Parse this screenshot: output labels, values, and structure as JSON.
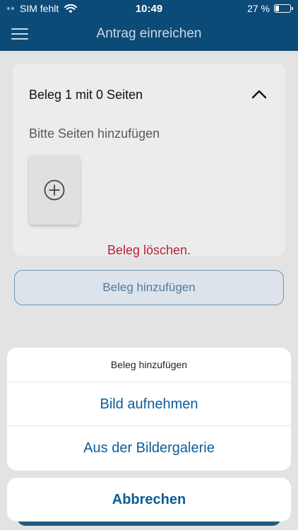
{
  "status_bar": {
    "carrier": "SIM fehlt",
    "time": "10:49",
    "battery_text": "27 %",
    "battery_level": 0.27,
    "icons": [
      "signal-dots-icon",
      "wifi-icon",
      "battery-icon"
    ]
  },
  "nav": {
    "title": "Antrag einreichen",
    "menu_icon": "hamburger-menu-icon"
  },
  "card": {
    "title": "Beleg 1 mit 0 Seiten",
    "collapse_icon": "chevron-up-icon",
    "subtitle": "Bitte Seiten hinzufügen",
    "add_page_icon": "plus-circle-icon",
    "delete_label": "Beleg löschen."
  },
  "add_button": {
    "label": "Beleg hinzufügen"
  },
  "action_sheet": {
    "title": "Beleg hinzufügen",
    "options": [
      {
        "label": "Bild aufnehmen"
      },
      {
        "label": "Aus der Bildergalerie"
      }
    ],
    "cancel_label": "Abbrechen"
  },
  "colors": {
    "nav_background": "#0c4a78",
    "action_text": "#0c5d97",
    "destructive_text": "#b3263a"
  }
}
